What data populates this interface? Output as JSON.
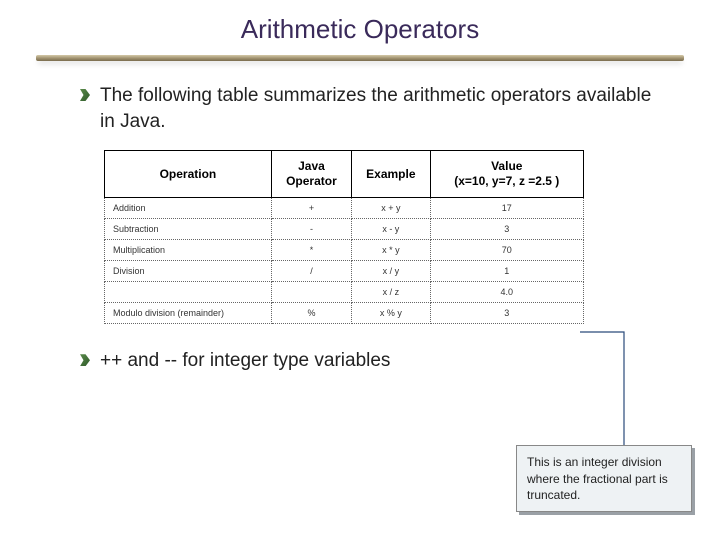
{
  "title": "Arithmetic Operators",
  "bullets": {
    "intro": "The following table summarizes the arithmetic operators available in Java.",
    "second": "++ and -- for integer type variables"
  },
  "table": {
    "headers": {
      "operation": "Operation",
      "operator": "Java\nOperator",
      "example": "Example",
      "value": "Value\n(x=10, y=7, z =2.5 )"
    },
    "rows": [
      {
        "operation": "Addition",
        "operator": "+",
        "example": "x + y",
        "value": "17"
      },
      {
        "operation": "Subtraction",
        "operator": "-",
        "example": "x - y",
        "value": "3"
      },
      {
        "operation": "Multiplication",
        "operator": "*",
        "example": "x * y",
        "value": "70"
      },
      {
        "operation": "Division",
        "operator": "/",
        "example": "x / y",
        "value": "1"
      },
      {
        "operation": "",
        "operator": "",
        "example": "x / z",
        "value": "4.0"
      },
      {
        "operation": "Modulo division (remainder)",
        "operator": "%",
        "example": "x % y",
        "value": "3"
      }
    ]
  },
  "callout": "This is an integer division where the fractional part is truncated."
}
